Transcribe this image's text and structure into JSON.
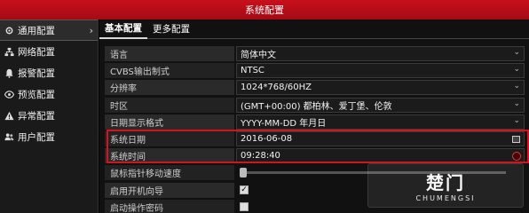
{
  "window": {
    "title": "系统配置"
  },
  "sidebar": {
    "items": [
      {
        "label": "通用配置",
        "icon": "gear-icon",
        "active": true
      },
      {
        "label": "网络配置",
        "icon": "network-icon"
      },
      {
        "label": "报警配置",
        "icon": "bell-icon"
      },
      {
        "label": "预览配置",
        "icon": "eye-icon"
      },
      {
        "label": "异常配置",
        "icon": "warning-icon"
      },
      {
        "label": "用户配置",
        "icon": "users-icon"
      }
    ]
  },
  "tabs": [
    {
      "label": "基本配置",
      "active": true
    },
    {
      "label": "更多配置"
    }
  ],
  "settings": {
    "language": {
      "label": "语言",
      "value": "简体中文"
    },
    "cvbs": {
      "label": "CVBS输出制式",
      "value": "NTSC"
    },
    "resolution": {
      "label": "分辨率",
      "value": "1024*768/60HZ"
    },
    "timezone": {
      "label": "时区",
      "value": "(GMT+00:00) 都柏林、爱丁堡、伦敦"
    },
    "date_format": {
      "label": "日期显示格式",
      "value": "YYYY-MM-DD 年月日"
    },
    "system_date": {
      "label": "系统日期",
      "value": "2016-06-08"
    },
    "system_time": {
      "label": "系统时间",
      "value": "09:28:40"
    },
    "mouse_speed": {
      "label": "鼠标指针移动速度"
    },
    "startup_wizard": {
      "label": "启用开机向导",
      "checked": true
    },
    "password": {
      "label": "启动操作密码",
      "checked": false
    }
  },
  "watermark": {
    "top": "楚门",
    "bottom": "CHUMENGSI"
  },
  "colors": {
    "title_bar": "#b50d18",
    "highlight": "#d3141f"
  }
}
